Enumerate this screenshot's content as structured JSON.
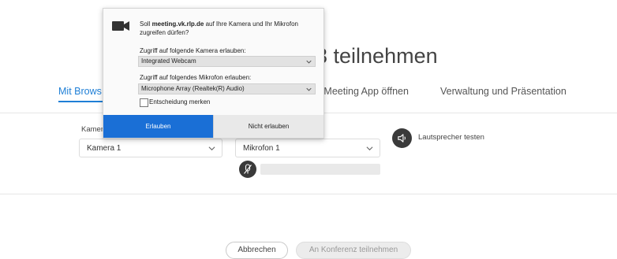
{
  "page": {
    "title": "3 teilnehmen",
    "tabs": [
      "Mit Brows",
      "o Meeting App öffnen",
      "Verwaltung und Präsentation"
    ],
    "camera_label": "Kamera",
    "camera_value": "Kamera 1",
    "mic_value": "Mikrofon 1",
    "speaker_test_label": "Lautsprecher testen",
    "cancel_label": "Abbrechen",
    "join_label": "An Konferenz teilnehmen"
  },
  "dialog": {
    "question_prefix": "Soll ",
    "domain": "meeting.vk.rlp.de",
    "question_suffix": " auf Ihre Kamera und Ihr Mikrofon zugreifen dürfen?",
    "camera_prompt": "Zugriff auf folgende Kamera erlauben:",
    "camera_choice": "Integrated Webcam",
    "mic_prompt": "Zugriff auf folgendes Mikrofon erlauben:",
    "mic_choice": "Microphone Array (Realtek(R) Audio)",
    "remember_label": "Entscheidung merken",
    "remember_checked": false,
    "allow_label": "Erlauben",
    "deny_label": "Nicht erlauben"
  },
  "colors": {
    "accent": "#1f7fd6",
    "allow_button": "#1a6fd6",
    "icon_dark": "#3a3a3a"
  },
  "icons": [
    "camera-icon",
    "chevron-down-icon",
    "speaker-icon",
    "microphone-muted-icon"
  ]
}
